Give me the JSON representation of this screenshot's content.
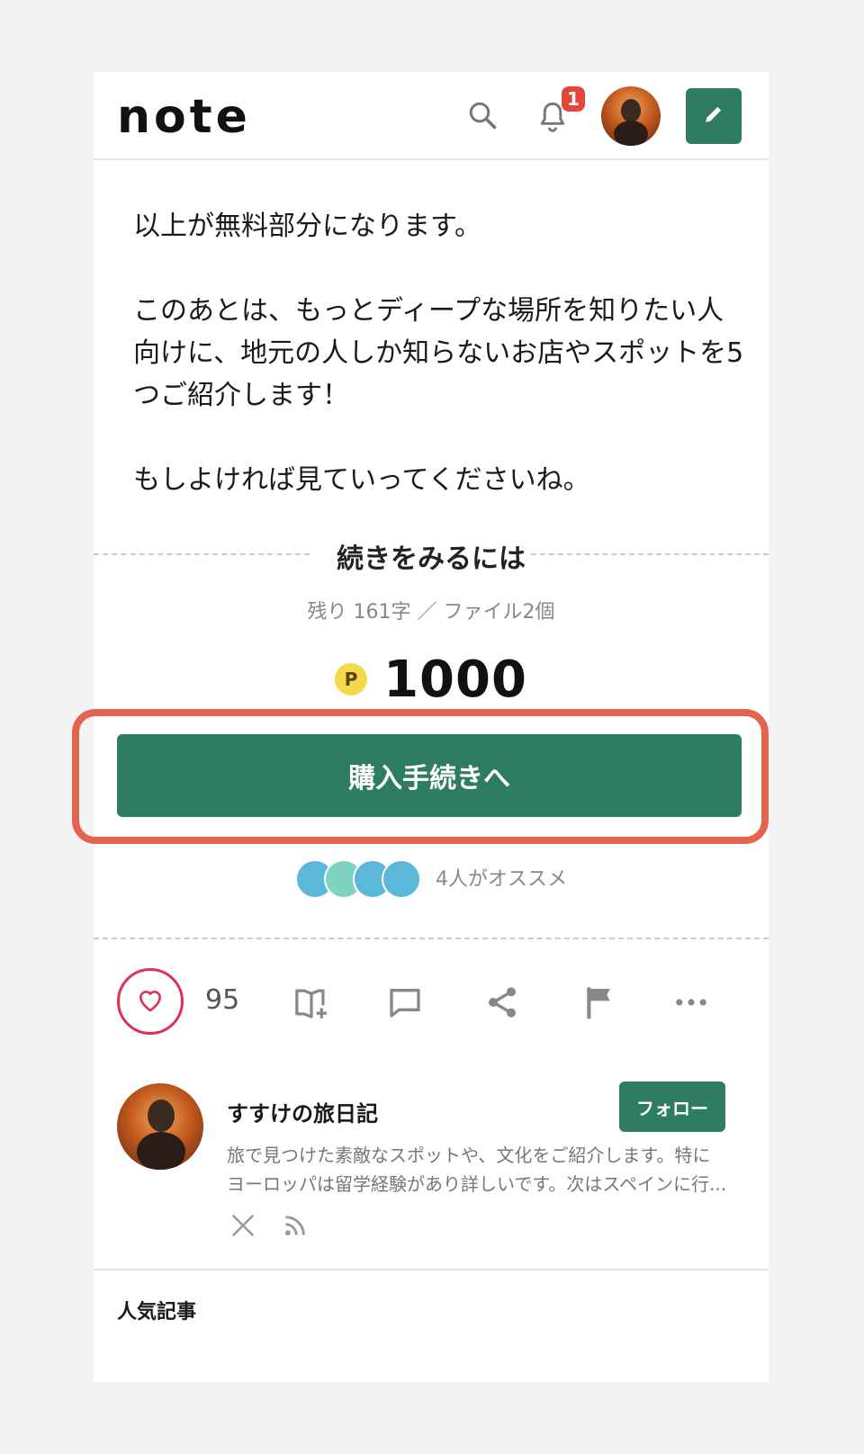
{
  "header": {
    "logo": "note",
    "notification_count": "1"
  },
  "article": {
    "paragraphs": [
      "以上が無料部分になります。",
      "このあとは、もっとディープな場所を知りたい人向けに、地元の人しか知らないお店やスポットを5つご紹介します！",
      "もしよければ見ていってくださいね。"
    ]
  },
  "paywall": {
    "title": "続きをみるには",
    "remaining": "残り 161字 ／ ファイル2個",
    "point_symbol": "P",
    "price": "1000",
    "buy_label": "購入手続きへ",
    "recommend_text": "4人がオススメ"
  },
  "actions": {
    "like_count": "95"
  },
  "author": {
    "name": "すすけの旅日記",
    "follow_label": "フォロー",
    "description_line1": "旅で見つけた素敵なスポットや、文化をご紹介します。特に",
    "description_line2": "ヨーロッパは留学経験があり詳しいです。次はスペインに行..."
  },
  "sections": {
    "popular_title": "人気記事"
  },
  "colors": {
    "accent_green": "#2e7d62",
    "highlight_border": "#e4654f",
    "like_pink": "#e0305a",
    "badge_red": "#e5463a",
    "point_yellow": "#f5d94a"
  },
  "icons": [
    "search-icon",
    "bell-icon",
    "pencil-icon",
    "heart-icon",
    "magazine-add-icon",
    "comment-icon",
    "share-icon",
    "flag-icon",
    "more-icon",
    "x-icon",
    "rss-icon"
  ]
}
